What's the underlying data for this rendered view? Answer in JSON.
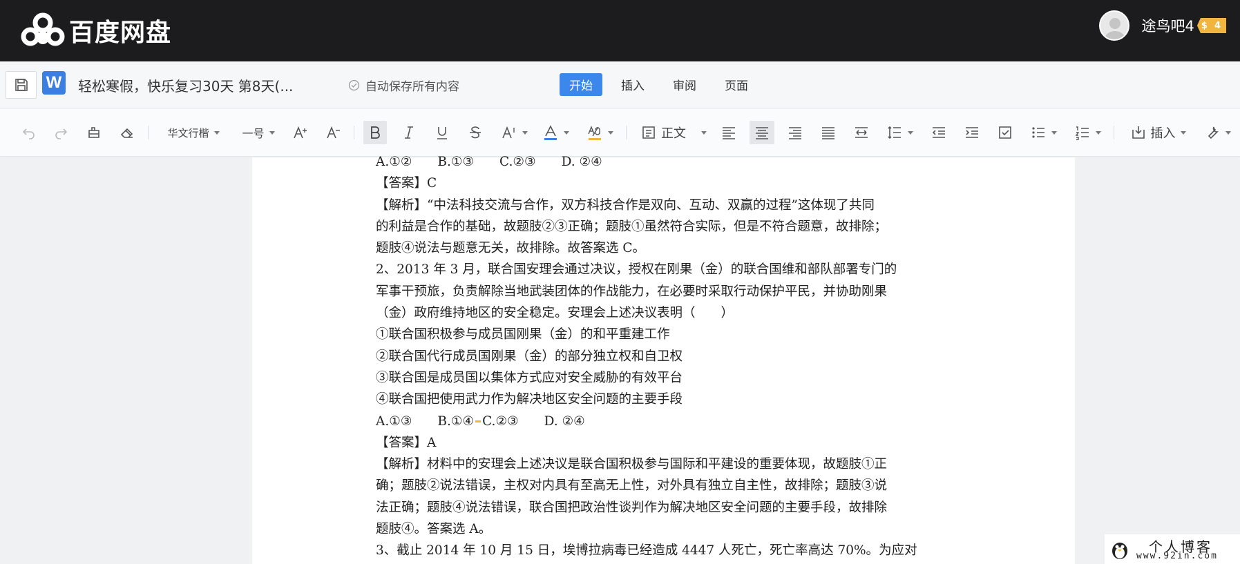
{
  "app": {
    "brand": "百度网盘",
    "user": {
      "name": "途鸟吧4",
      "vip_icon": "$",
      "vip_level": "4"
    }
  },
  "doc": {
    "title": "轻松寒假，快乐复习30天 第8天(...",
    "autosave": "自动保存所有内容",
    "tabs": [
      {
        "label": "开始",
        "active": true
      },
      {
        "label": "插入",
        "active": false
      },
      {
        "label": "审阅",
        "active": false
      },
      {
        "label": "页面",
        "active": false
      }
    ]
  },
  "toolbar": {
    "font_family": "华文行楷",
    "font_size": "一号",
    "style": "正文",
    "insert_label": "插入",
    "font_color": "#3b7fe3",
    "highlight_color": "#f0b53f"
  },
  "document": {
    "lines": [
      "A.①②　　B.①③　　C.②③　　D. ②④",
      "【答案】C",
      "【解析】“中法科技交流与合作，双方科技合作是双向、互动、双赢的过程”这体现了共同",
      "的利益是合作的基础，故题肢②③正确；题肢①虽然符合实际，但是不符合题意，故排除；",
      "题肢④说法与题意无关，故排除。故答案选 C。",
      "2、2013 年 3 月，联合国安理会通过决议，授权在刚果（金）的联合国维和部队部署专门的",
      "军事干预旅，负责解除当地武装团体的作战能力，在必要时采取行动保护平民，并协助刚果",
      "（金）政府维持地区的安全稳定。安理会上述决议表明（　　）",
      "①联合国积极参与成员国刚果（金）的和平重建工作",
      "②联合国代行成员国刚果（金）的部分独立权和自卫权",
      "③联合国是成员国以集体方式应对安全威胁的有效平台",
      "④联合国把使用武力作为解决地区安全问题的主要手段",
      "A.①③　　B.①④",
      "C.②③　　D. ②④",
      "【答案】A",
      "【解析】材料中的安理会上述决议是联合国积极参与国际和平建设的重要体现，故题肢①正",
      "确；题肢②说法错误，主权对内具有至高无上性，对外具有独立自主性，故排除；题肢③说",
      "法正确；题肢④说法错误，联合国把政治性谈判作为解决地区安全问题的主要手段，故排除",
      "题肢④。答案选 A。",
      "3、截止 2014 年 10 月 15 日，埃博拉病毒已经造成 4447 人死亡，死亡率",
      "高达 70%。为应对"
    ]
  },
  "watermark": {
    "title": "个人博客",
    "url": "www.92in.com"
  }
}
